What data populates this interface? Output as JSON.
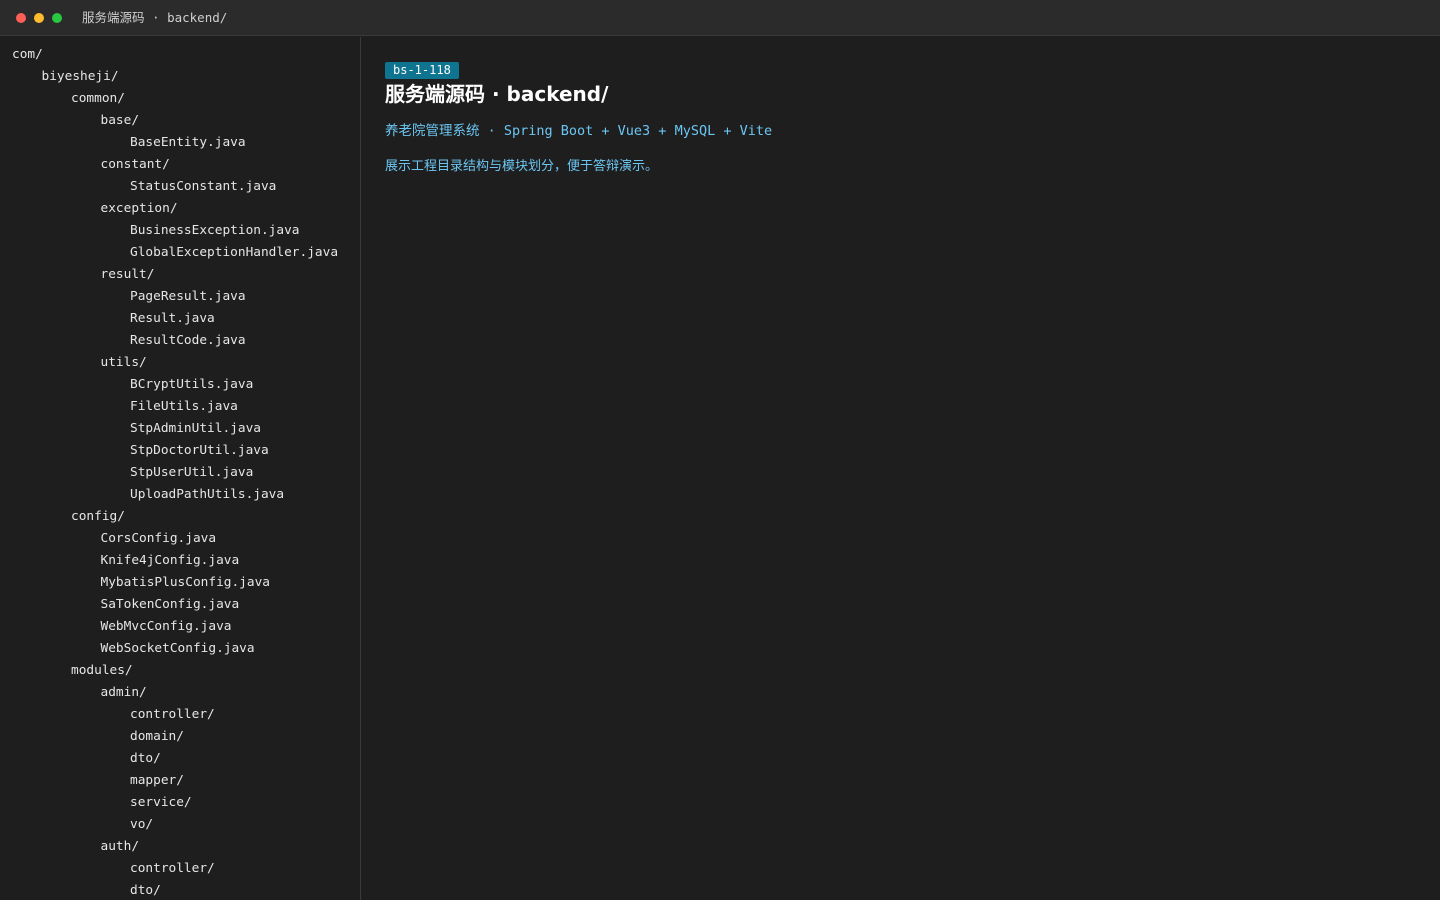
{
  "window": {
    "title": "服务端源码 · backend/"
  },
  "tree": [
    {
      "label": "com/",
      "depth": 0
    },
    {
      "label": "biyesheji/",
      "depth": 1
    },
    {
      "label": "common/",
      "depth": 2
    },
    {
      "label": "base/",
      "depth": 3
    },
    {
      "label": "BaseEntity.java",
      "depth": 4
    },
    {
      "label": "constant/",
      "depth": 3
    },
    {
      "label": "StatusConstant.java",
      "depth": 4
    },
    {
      "label": "exception/",
      "depth": 3
    },
    {
      "label": "BusinessException.java",
      "depth": 4
    },
    {
      "label": "GlobalExceptionHandler.java",
      "depth": 4
    },
    {
      "label": "result/",
      "depth": 3
    },
    {
      "label": "PageResult.java",
      "depth": 4
    },
    {
      "label": "Result.java",
      "depth": 4
    },
    {
      "label": "ResultCode.java",
      "depth": 4
    },
    {
      "label": "utils/",
      "depth": 3
    },
    {
      "label": "BCryptUtils.java",
      "depth": 4
    },
    {
      "label": "FileUtils.java",
      "depth": 4
    },
    {
      "label": "StpAdminUtil.java",
      "depth": 4
    },
    {
      "label": "StpDoctorUtil.java",
      "depth": 4
    },
    {
      "label": "StpUserUtil.java",
      "depth": 4
    },
    {
      "label": "UploadPathUtils.java",
      "depth": 4
    },
    {
      "label": "config/",
      "depth": 2
    },
    {
      "label": "CorsConfig.java",
      "depth": 3
    },
    {
      "label": "Knife4jConfig.java",
      "depth": 3
    },
    {
      "label": "MybatisPlusConfig.java",
      "depth": 3
    },
    {
      "label": "SaTokenConfig.java",
      "depth": 3
    },
    {
      "label": "WebMvcConfig.java",
      "depth": 3
    },
    {
      "label": "WebSocketConfig.java",
      "depth": 3
    },
    {
      "label": "modules/",
      "depth": 2
    },
    {
      "label": "admin/",
      "depth": 3
    },
    {
      "label": "controller/",
      "depth": 4
    },
    {
      "label": "domain/",
      "depth": 4
    },
    {
      "label": "dto/",
      "depth": 4
    },
    {
      "label": "mapper/",
      "depth": 4
    },
    {
      "label": "service/",
      "depth": 4
    },
    {
      "label": "vo/",
      "depth": 4
    },
    {
      "label": "auth/",
      "depth": 3
    },
    {
      "label": "controller/",
      "depth": 4
    },
    {
      "label": "dto/",
      "depth": 4
    }
  ],
  "main": {
    "badge": "bs-1-118",
    "heading": "服务端源码 · backend/",
    "tech_stack": "养老院管理系统 · Spring Boot + Vue3 + MySQL + Vite",
    "description": "展示工程目录结构与模块划分，便于答辩演示。"
  },
  "colors": {
    "background": "#1e1e1e",
    "titlebar": "#2b2b2b",
    "badge": "#0e7490",
    "accent_text": "#6cc6f3"
  }
}
